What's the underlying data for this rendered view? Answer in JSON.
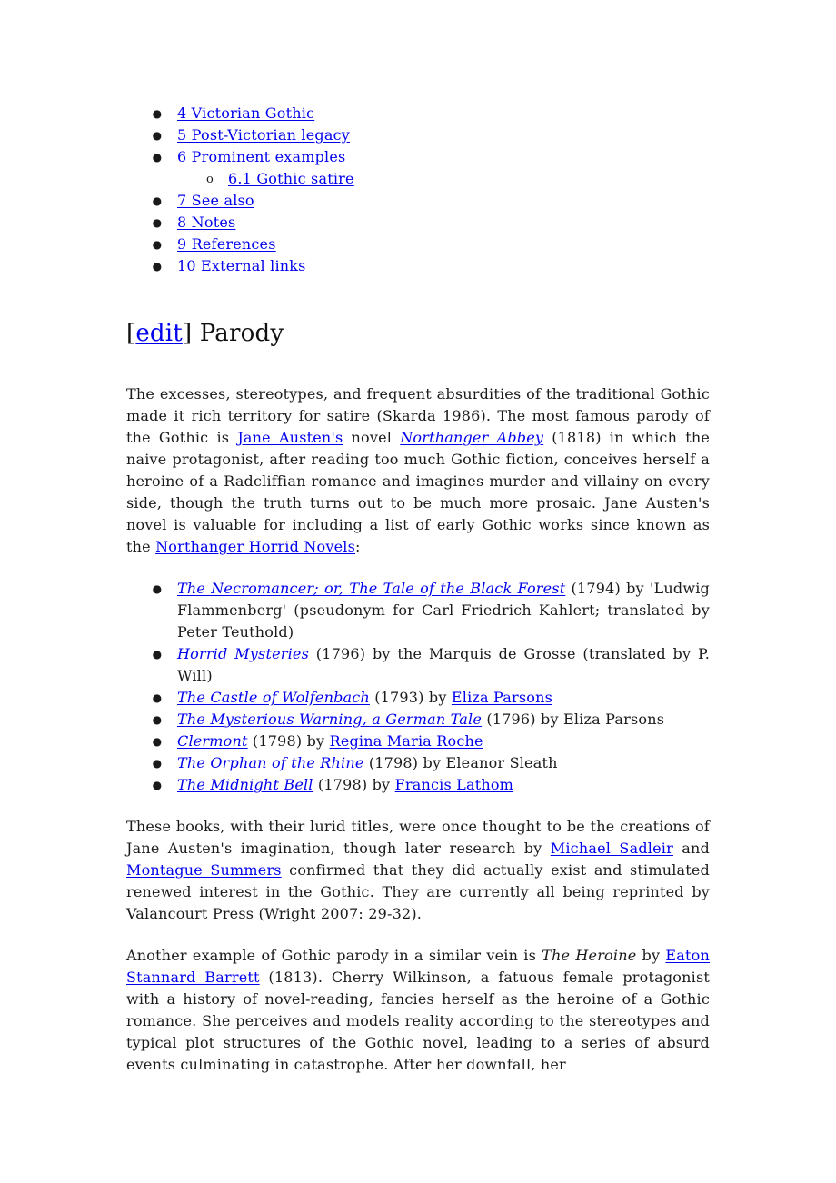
{
  "toc": {
    "items": [
      {
        "label": "4 Victorian Gothic"
      },
      {
        "label": "5 Post-Victorian legacy"
      },
      {
        "label": "6 Prominent examples",
        "sub": [
          {
            "label": "6.1 Gothic satire"
          }
        ]
      },
      {
        "label": "7 See also"
      },
      {
        "label": "8 Notes"
      },
      {
        "label": "9 References"
      },
      {
        "label": "10 External links"
      }
    ],
    "bullet": "●",
    "sub_bullet": "o"
  },
  "section": {
    "bracket_open": "[",
    "edit_label": "edit",
    "bracket_close": "]",
    "title": "Parody"
  },
  "para1": {
    "t1": "The excesses, stereotypes, and frequent absurdities of the traditional Gothic made it rich territory for satire (Skarda 1986). The most famous parody of the Gothic is ",
    "link1": "Jane Austen's",
    "t2": " novel ",
    "link2": "Northanger Abbey",
    "t3": " (1818) in which the naive protagonist, after reading too much Gothic fiction, conceives herself a heroine of a Radcliffian romance and imagines murder and villainy on every side, though the truth turns out to be much more prosaic. Jane Austen's novel is valuable for including a list of early Gothic works since known as the ",
    "link3": "Northanger Horrid Novels",
    "t4": ":"
  },
  "books": [
    {
      "title": "The Necromancer; or, The Tale of the Black Forest",
      "rest": " (1794) by 'Ludwig Flammenberg' (pseudonym for Carl Friedrich Kahlert; translated by Peter Teuthold)",
      "author_link": ""
    },
    {
      "title": "Horrid Mysteries",
      "rest": " (1796) by the Marquis de Grosse (translated by P. Will)",
      "author_link": ""
    },
    {
      "title": "The Castle of Wolfenbach",
      "rest": " (1793) by ",
      "author_link": "Eliza Parsons"
    },
    {
      "title": "The Mysterious Warning, a German Tale",
      "rest": " (1796) by Eliza Parsons",
      "author_link": ""
    },
    {
      "title": "Clermont",
      "rest": " (1798) by ",
      "author_link": "Regina Maria Roche"
    },
    {
      "title": "The Orphan of the Rhine",
      "rest": " (1798) by Eleanor Sleath",
      "author_link": ""
    },
    {
      "title": "The Midnight Bell",
      "rest": " (1798) by ",
      "author_link": "Francis Lathom"
    }
  ],
  "para2": {
    "t1": "These books, with their lurid titles, were once thought to be the creations of Jane Austen's imagination, though later research by ",
    "link1": "Michael Sadleir",
    "t2": " and ",
    "link2": "Montague Summers",
    "t3": " confirmed that they did actually exist and stimulated renewed interest in the Gothic. They are currently all being reprinted by Valancourt Press (Wright 2007: 29-32)."
  },
  "para3": {
    "t1": "Another example of Gothic parody in a similar vein is ",
    "italic": "The Heroine",
    "t2": " by ",
    "link1": "Eaton Stannard Barrett",
    "t3": " (1813). Cherry Wilkinson, a fatuous female protagonist with a history of novel-reading, fancies herself as the heroine of a Gothic romance. She perceives and models reality according to the stereotypes and typical plot structures of the Gothic novel, leading to a series of absurd events culminating in catastrophe. After her downfall, her"
  },
  "colors": {
    "link": "#0000ee",
    "text": "#1a1a1a"
  }
}
